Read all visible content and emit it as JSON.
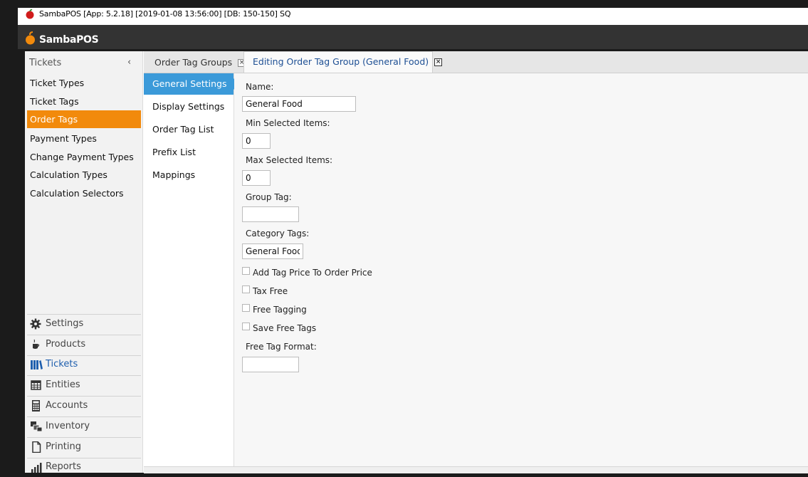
{
  "window": {
    "title": "SambaPOS [App: 5.2.18] [2019-01-08 13:56:00] [DB: 150-150] SQ"
  },
  "appbar": {
    "brand": "SambaPOS"
  },
  "leftnav": {
    "header": "Tickets",
    "collapse_icon": "‹",
    "items": [
      {
        "label": "Ticket Types"
      },
      {
        "label": "Ticket Tags"
      },
      {
        "label": "Order Tags",
        "active": true
      },
      {
        "label": "Payment Types"
      },
      {
        "label": "Change Payment Types"
      },
      {
        "label": "Calculation Types"
      },
      {
        "label": "Calculation Selectors"
      }
    ],
    "modules": [
      {
        "label": "Settings",
        "icon": "gear-icon"
      },
      {
        "label": "Products",
        "icon": "coffee-cup-icon"
      },
      {
        "label": "Tickets",
        "icon": "books-icon",
        "active": true
      },
      {
        "label": "Entities",
        "icon": "table-icon"
      },
      {
        "label": "Accounts",
        "icon": "calculator-icon"
      },
      {
        "label": "Inventory",
        "icon": "boxes-icon"
      },
      {
        "label": "Printing",
        "icon": "document-icon"
      },
      {
        "label": "Reports",
        "icon": "bar-chart-icon"
      }
    ]
  },
  "tabs": [
    {
      "label": "Order Tag Groups",
      "close": "×"
    },
    {
      "label": "Editing Order Tag Group (General Food)",
      "close": "×",
      "active": true
    }
  ],
  "sections": [
    {
      "label": "General Settings",
      "active": true
    },
    {
      "label": "Display Settings"
    },
    {
      "label": "Order Tag List"
    },
    {
      "label": "Prefix List"
    },
    {
      "label": "Mappings"
    }
  ],
  "form": {
    "name_label": "Name:",
    "name_value": "General Food",
    "min_label": "Min Selected Items:",
    "min_value": "0",
    "max_label": "Max Selected Items:",
    "max_value": "0",
    "group_tag_label": "Group Tag:",
    "group_tag_value": "",
    "category_tags_label": "Category Tags:",
    "category_tags_value": "General Food",
    "checkboxes": [
      {
        "label": "Add Tag Price To Order Price",
        "checked": false
      },
      {
        "label": "Tax Free",
        "checked": false
      },
      {
        "label": "Free Tagging",
        "checked": false
      },
      {
        "label": "Save Free Tags",
        "checked": false
      }
    ],
    "free_tag_format_label": "Free Tag Format:",
    "free_tag_format_value": ""
  },
  "colors": {
    "accent_orange": "#f28a0c",
    "accent_blue": "#3b9ad9",
    "link_blue": "#1f5fae"
  }
}
